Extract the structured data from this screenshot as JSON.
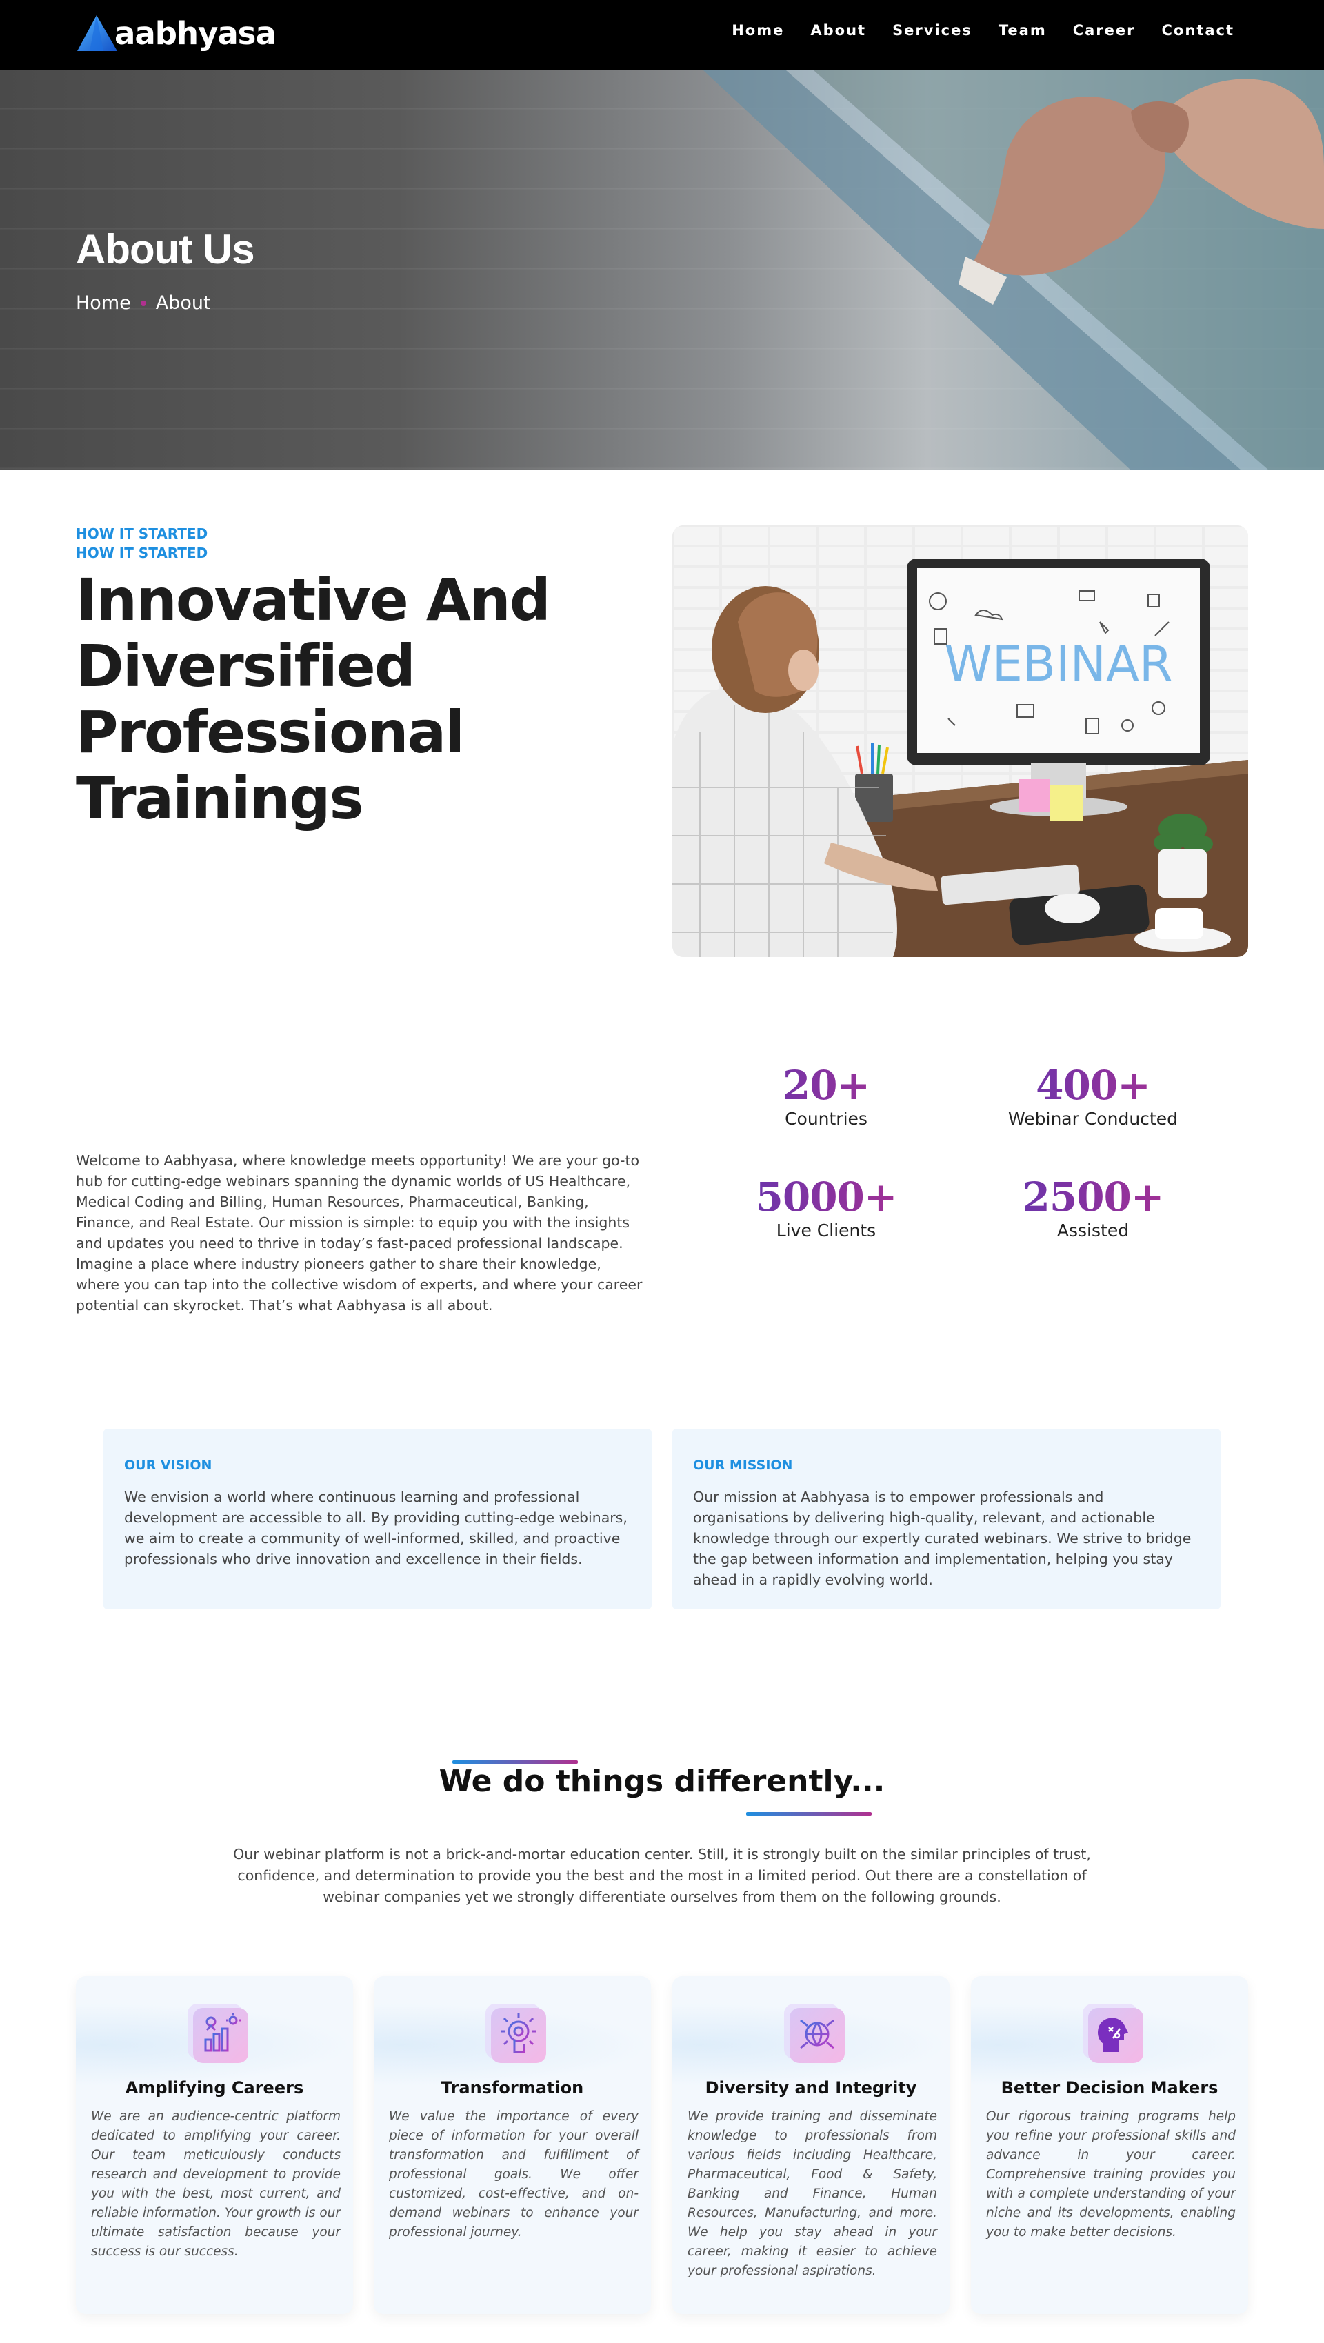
{
  "nav": {
    "brand": "aabhyasa",
    "links": [
      "Home",
      "About",
      "Services",
      "Team",
      "Career",
      "Contact"
    ]
  },
  "hero": {
    "title": "About Us",
    "breadcrumb": [
      "Home",
      "About"
    ]
  },
  "about": {
    "eyebrow": "HOW IT STARTED",
    "eyebrow_repeat": "HOW IT STARTED",
    "heading_lines": [
      "Innovative And",
      "Diversified",
      "Professional",
      "Trainings"
    ],
    "image_text": "WEBINAR",
    "welcome": "Welcome to Aabhyasa, where knowledge meets opportunity! We are your go-to hub for cutting-edge webinars spanning the dynamic worlds of US Healthcare, Medical Coding and Billing, Human Resources, Pharmaceutical, Banking, Finance, and Real Estate. Our mission is simple: to equip you with the insights and updates you need to thrive in today’s fast-paced professional landscape. Imagine a place where industry pioneers gather to share their knowledge, where you can tap into the collective wisdom of experts, and where your career potential can skyrocket. That’s what Aabhyasa is all about."
  },
  "stats": [
    {
      "value": "20+",
      "label": "Countries"
    },
    {
      "value": "400+",
      "label": "Webinar Conducted"
    },
    {
      "value": "5000+",
      "label": "Live Clients"
    },
    {
      "value": "2500+",
      "label": "Assisted"
    }
  ],
  "vision": {
    "title": "OUR VISION",
    "text": "We envision a world where continuous learning and professional development are accessible to all. By providing cutting-edge webinars, we aim to create a community of well-informed, skilled, and proactive professionals who drive innovation and excellence in their fields."
  },
  "mission": {
    "title": "OUR MISSION",
    "text": "Our mission at Aabhyasa is to empower professionals and organisations by delivering high-quality, relevant, and actionable knowledge through our expertly curated webinars. We strive to bridge the gap between information and implementation, helping you stay ahead in a rapidly evolving world."
  },
  "differently": {
    "title": "We do things differently...",
    "subtitle": "Our webinar platform is not a brick-and-mortar education center. Still, it is strongly built on the similar principles of trust, confidence, and determination to provide you the best and the most in a limited period. Out there are a constellation of webinar companies yet we strongly differentiate ourselves from them on the following grounds.",
    "features": [
      {
        "icon": "career-growth-icon",
        "title": "Amplifying Careers",
        "text": "We are an audience-centric platform dedicated to amplifying your career. Our team meticulously conducts research and development to provide you with the best, most current, and reliable information. Your growth is our ultimate satisfaction because your success is our success."
      },
      {
        "icon": "touch-transformation-icon",
        "title": "Transformation",
        "text": "We value the importance of every piece of information for your overall transformation and fulfillment of professional goals. We offer customized, cost-effective, and on-demand webinars to enhance your professional journey."
      },
      {
        "icon": "globe-hands-icon",
        "title": "Diversity and Integrity",
        "text": "We provide training and disseminate knowledge to professionals from various fields including Healthcare, Pharmaceutical, Food & Safety, Banking and Finance, Human Resources, Manufacturing, and more. We help you stay ahead in your career, making it easier to achieve your professional aspirations."
      },
      {
        "icon": "decision-head-icon",
        "title": "Better Decision Makers",
        "text": "Our rigorous training programs help you refine your professional skills and advance in your career. Comprehensive training provides you with a complete understanding of your niche and its developments, enabling you to make better decisions."
      }
    ]
  },
  "colors": {
    "accent_blue": "#1e8fe0",
    "accent_purple": "#5d35b0",
    "accent_magenta": "#b0308f",
    "nav_bg": "#000000",
    "card_bg": "#eef6fd"
  }
}
